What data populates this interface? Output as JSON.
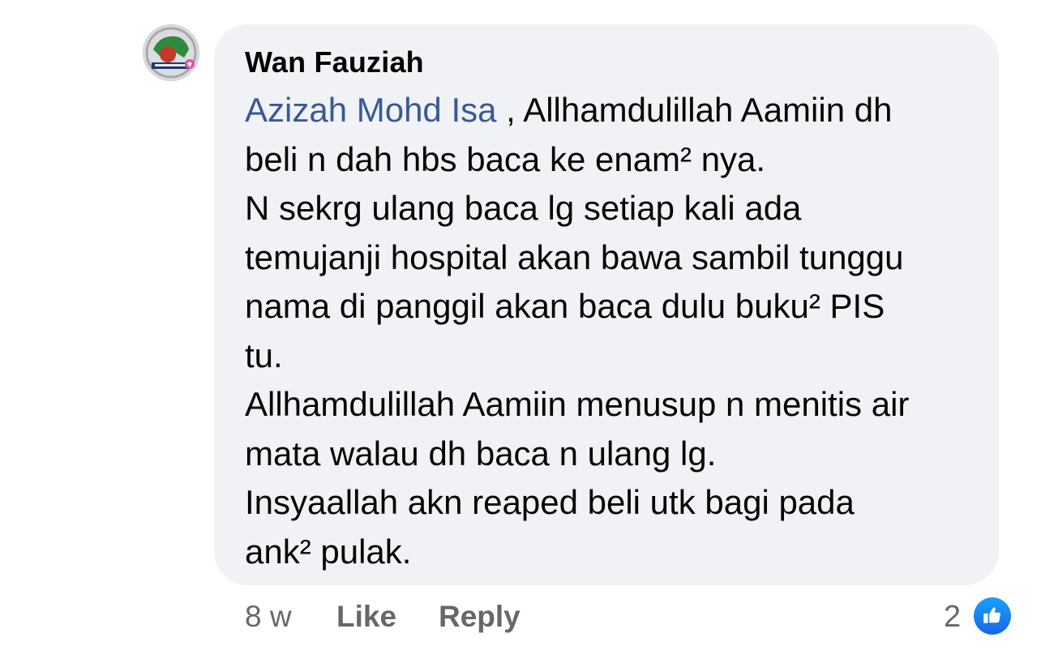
{
  "comment": {
    "author": "Wan Fauziah",
    "mention": "Azizah Mohd Isa",
    "lines": [
      " , Allhamdulillah Aamiin dh",
      "beli n dah hbs baca ke enam² nya.",
      "N sekrg ulang baca lg setiap kali ada",
      "temujanji hospital akan bawa sambil tunggu",
      "nama di panggil akan baca dulu buku² PIS",
      "tu.",
      "Allhamdulillah Aamiin menusup n menitis air",
      "mata walau dh baca n ulang lg.",
      "Insyaallah akn reaped beli utk bagi pada",
      "ank² pulak."
    ]
  },
  "actions": {
    "time": "8 w",
    "like_label": "Like",
    "reply_label": "Reply"
  },
  "reactions": {
    "count": "2",
    "icon": "like-icon",
    "color": "#1877f2"
  },
  "colors": {
    "bubble": "#f0f2f5",
    "mention": "#385898",
    "meta": "#65676b",
    "text": "#050505"
  }
}
